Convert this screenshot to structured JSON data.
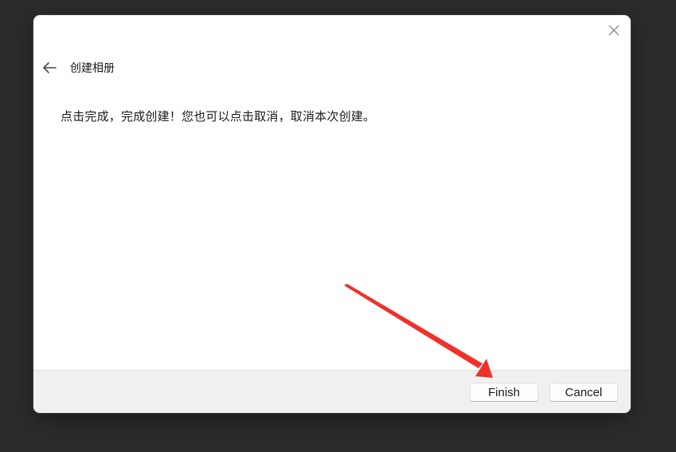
{
  "dialog": {
    "title": "创建相册",
    "message": "点击完成，完成创建！您也可以点击取消，取消本次创建。",
    "buttons": {
      "finish_label": "Finish",
      "cancel_label": "Cancel"
    }
  },
  "icons": {
    "back": "back-arrow-icon",
    "close": "close-icon",
    "annotation": "red-arrow-annotation"
  },
  "colors": {
    "backdrop": "#2b2b2b",
    "dialog_bg": "#ffffff",
    "footer_bg": "#f0f0f0",
    "annotation_arrow": "#f0312b"
  }
}
